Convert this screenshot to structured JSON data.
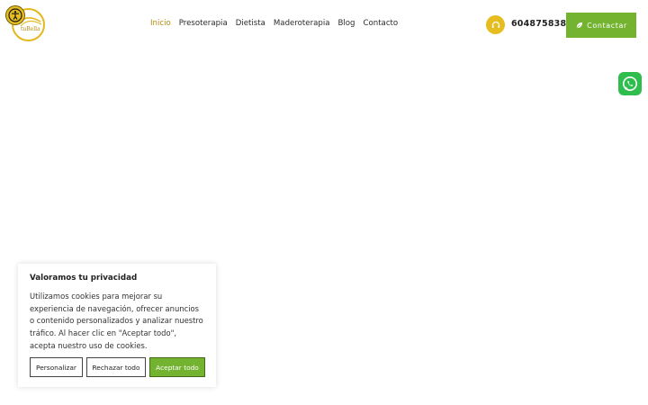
{
  "logo": {
    "text": "tuBella"
  },
  "nav": {
    "items": [
      {
        "label": "Inicio",
        "active": true
      },
      {
        "label": "Presoterapia"
      },
      {
        "label": "Dietista"
      },
      {
        "label": "Maderoterapia"
      },
      {
        "label": "Blog"
      },
      {
        "label": "Contacto"
      }
    ]
  },
  "header": {
    "phone": "604875838",
    "contact_label": "Contactar"
  },
  "colors": {
    "accent_gold": "#e6bd1e",
    "active_nav": "#b48a10",
    "button_green": "#74b330",
    "whatsapp_green": "#2fbd4e"
  },
  "cookie": {
    "title": "Valoramos tu privacidad",
    "text": "Utilizamos cookies para mejorar su experiencia de navegación, ofrecer anuncios o contenido personalizados y analizar nuestro tráfico. Al hacer clic en \"Aceptar todo\", acepta nuestro uso de cookies.",
    "buttons": {
      "customize": "Personalizar",
      "reject": "Rechazar todo",
      "accept": "Aceptar todo"
    }
  }
}
